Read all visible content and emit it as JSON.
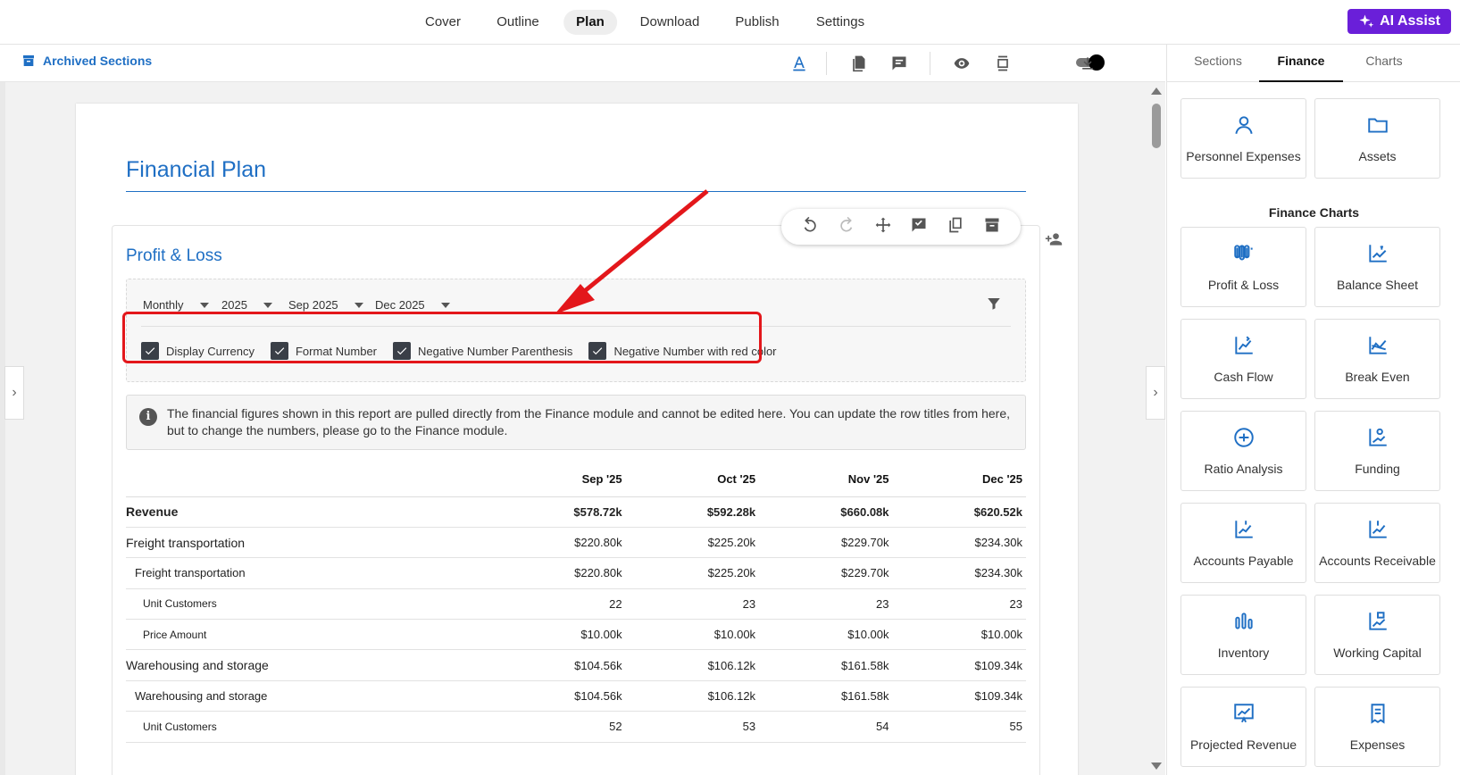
{
  "nav": {
    "tabs": [
      "Cover",
      "Outline",
      "Plan",
      "Download",
      "Publish",
      "Settings"
    ],
    "active": "Plan",
    "ai_assist": "AI Assist"
  },
  "toolbar": {
    "archived_sections": "Archived Sections",
    "icons": [
      "text-color-icon",
      "document-icon",
      "comment-icon",
      "eye-icon",
      "page-layout-icon",
      "toggle-switch",
      "download-icon"
    ]
  },
  "document": {
    "title": "Financial Plan",
    "section_title": "Profit & Loss",
    "filters": {
      "period": "Monthly",
      "year": "2025",
      "from": "Sep 2025",
      "to": "Dec 2025"
    },
    "options": [
      {
        "label": "Display Currency",
        "checked": true
      },
      {
        "label": "Format Number",
        "checked": true
      },
      {
        "label": "Negative Number Parenthesis",
        "checked": true
      },
      {
        "label": "Negative Number with red color",
        "checked": true
      }
    ],
    "info": "The financial figures shown in this report are pulled directly from the Finance module and cannot be edited here. You can update the row titles from here, but to change the numbers, please go to the Finance module.",
    "table": {
      "columns": [
        "",
        "Sep '25",
        "Oct '25",
        "Nov '25",
        "Dec '25"
      ],
      "rows": [
        {
          "label": "Revenue",
          "level": 0,
          "bold": true,
          "values": [
            "$578.72k",
            "$592.28k",
            "$660.08k",
            "$620.52k"
          ]
        },
        {
          "label": "Freight transportation",
          "level": 0,
          "bold": false,
          "values": [
            "$220.80k",
            "$225.20k",
            "$229.70k",
            "$234.30k"
          ]
        },
        {
          "label": "Freight transportation",
          "level": 1,
          "bold": false,
          "values": [
            "$220.80k",
            "$225.20k",
            "$229.70k",
            "$234.30k"
          ]
        },
        {
          "label": "Unit Customers",
          "level": 2,
          "bold": false,
          "values": [
            "22",
            "23",
            "23",
            "23"
          ]
        },
        {
          "label": "Price Amount",
          "level": 2,
          "bold": false,
          "values": [
            "$10.00k",
            "$10.00k",
            "$10.00k",
            "$10.00k"
          ]
        },
        {
          "label": "Warehousing and storage",
          "level": 0,
          "bold": false,
          "values": [
            "$104.56k",
            "$106.12k",
            "$161.58k",
            "$109.34k"
          ]
        },
        {
          "label": "Warehousing and storage",
          "level": 1,
          "bold": false,
          "values": [
            "$104.56k",
            "$106.12k",
            "$161.58k",
            "$109.34k"
          ]
        },
        {
          "label": "Unit Customers",
          "level": 2,
          "bold": false,
          "values": [
            "52",
            "53",
            "54",
            "55"
          ]
        }
      ]
    }
  },
  "right_panel": {
    "tabs": [
      "Sections",
      "Finance",
      "Charts"
    ],
    "active_tab": "Finance",
    "top_cards": [
      {
        "label": "Personnel Expenses",
        "icon": "person-icon"
      },
      {
        "label": "Assets",
        "icon": "folder-icon"
      }
    ],
    "charts_heading": "Finance Charts",
    "chart_cards": [
      {
        "label": "Profit & Loss",
        "icon": "profit-loss-icon"
      },
      {
        "label": "Balance Sheet",
        "icon": "balance-sheet-icon"
      },
      {
        "label": "Cash Flow",
        "icon": "cash-flow-icon"
      },
      {
        "label": "Break Even",
        "icon": "break-even-icon"
      },
      {
        "label": "Ratio Analysis",
        "icon": "ratio-analysis-icon"
      },
      {
        "label": "Funding",
        "icon": "funding-icon"
      },
      {
        "label": "Accounts Payable",
        "icon": "accounts-payable-icon"
      },
      {
        "label": "Accounts Receivable",
        "icon": "accounts-receivable-icon"
      },
      {
        "label": "Inventory",
        "icon": "inventory-icon"
      },
      {
        "label": "Working Capital",
        "icon": "working-capital-icon"
      },
      {
        "label": "Projected Revenue",
        "icon": "projected-revenue-icon"
      },
      {
        "label": "Expenses",
        "icon": "expenses-icon"
      }
    ]
  },
  "colors": {
    "accent": "#1f6fc4",
    "ai": "#6a1fd9",
    "highlight": "#e3171b"
  }
}
